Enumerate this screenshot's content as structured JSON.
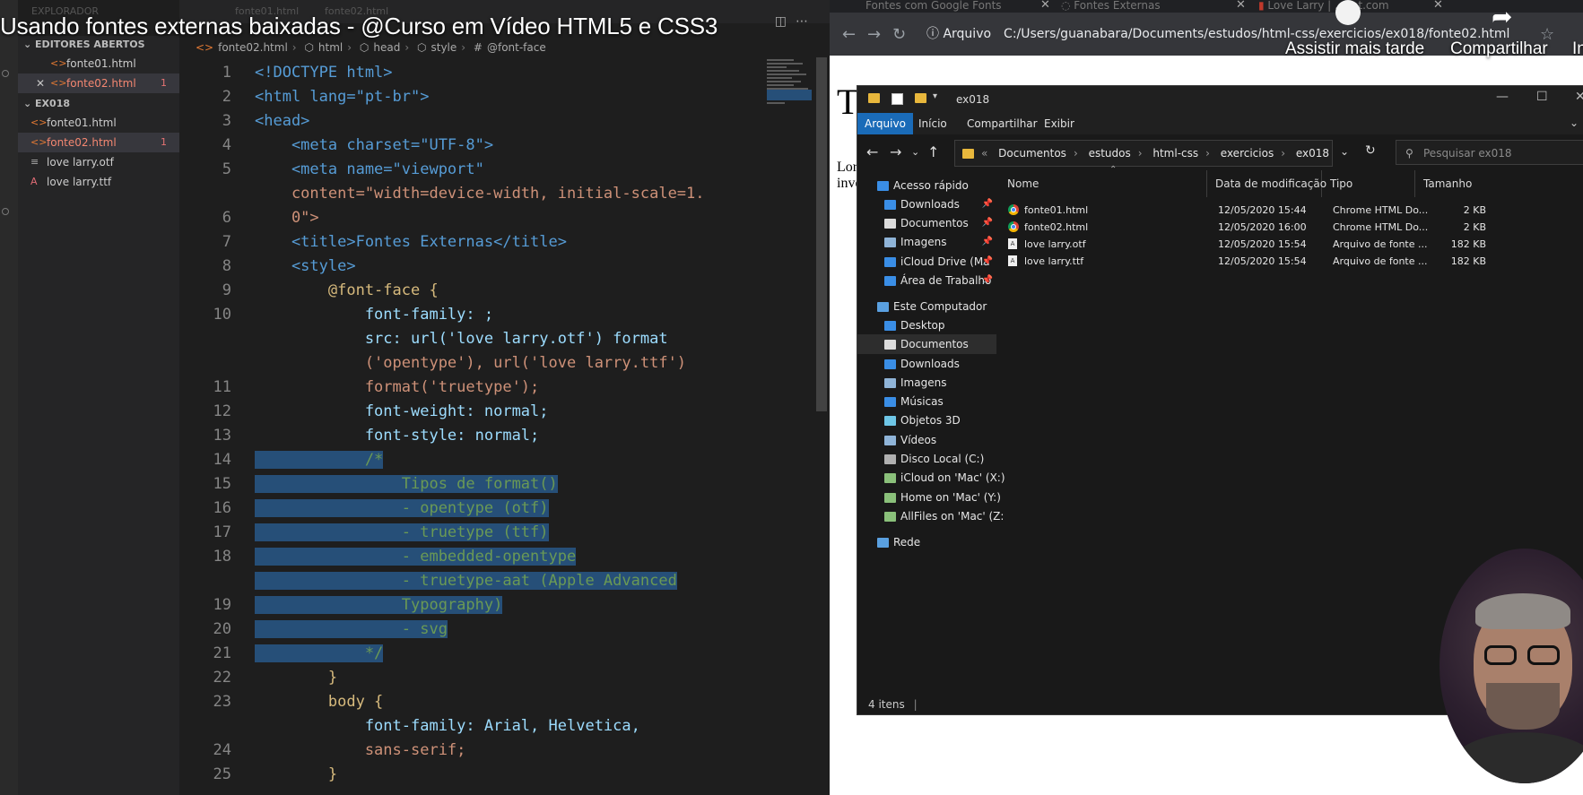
{
  "video": {
    "title": "Usando fontes externas baixadas - @Curso em Vídeo HTML5 e CSS3",
    "watch_later": "Assistir mais tarde",
    "share": "Compartilhar",
    "share_more": "In"
  },
  "vscode": {
    "faint_tabs": [
      "EXPLORADOR",
      "fonte01.html",
      "fonte02.html"
    ],
    "explorer": {
      "open_editors_header": "EDITORES ABERTOS",
      "open_editors": [
        {
          "name": "fonte01.html",
          "badge": ""
        },
        {
          "name": "fonte02.html",
          "badge": "1"
        }
      ],
      "folder_header": "EX018",
      "files": [
        {
          "name": "fonte01.html",
          "icon": "html-icon",
          "badge": ""
        },
        {
          "name": "fonte02.html",
          "icon": "html-icon",
          "badge": "1"
        },
        {
          "name": "love larry.otf",
          "icon": "font-file-icon",
          "badge": ""
        },
        {
          "name": "love larry.ttf",
          "icon": "font-file-icon",
          "badge": ""
        }
      ]
    },
    "breadcrumb": [
      "fonte02.html",
      "html",
      "head",
      "style",
      "@font-face"
    ],
    "line_numbers": [
      "1",
      "2",
      "3",
      "4",
      "5",
      "",
      "6",
      "7",
      "8",
      "9",
      "10",
      "",
      "",
      "11",
      "12",
      "13",
      "14",
      "15",
      "16",
      "17",
      "18",
      "",
      "19",
      "20",
      "21",
      "22",
      "23",
      "",
      "24",
      "25"
    ],
    "code_lines": [
      "<!DOCTYPE html>",
      "<html lang=\"pt-br\">",
      "<head>",
      "    <meta charset=\"UTF-8\">",
      "    <meta name=\"viewport\"",
      "    content=\"width=device-width, initial-scale=1.",
      "    0\">",
      "    <title>Fontes Externas</title>",
      "    <style>",
      "        @font-face {",
      "            font-family: ;",
      "            src: url('love larry.otf') format",
      "            ('opentype'), url('love larry.ttf')",
      "            format('truetype');",
      "            font-weight: normal;",
      "            font-style: normal;",
      "            /*",
      "                Tipos de format()",
      "                - opentype (otf)",
      "                - truetype (ttf)",
      "                - embedded-opentype",
      "                - truetype-aat (Apple Advanced",
      "                Typography)",
      "                - svg",
      "            */",
      "        }",
      "        body {",
      "            font-family: Arial, Helvetica,",
      "            sans-serif;",
      "        }"
    ]
  },
  "browser": {
    "tabs": [
      {
        "label": "Fontes com Google Fonts"
      },
      {
        "label": "Fontes Externas"
      },
      {
        "label": "Love Larry | ...ant.com"
      }
    ],
    "address_label": "Arquivo",
    "address_url": "C:/Users/guanabara/Documents/estudos/html-css/exercicios/ex018/fonte02.html",
    "page_heading_fragment": "T",
    "page_lorem_line1": "Lor",
    "page_lorem_line2": "inve"
  },
  "file_explorer": {
    "title": "ex018",
    "ribbon": [
      "Arquivo",
      "Início",
      "Compartilhar",
      "Exibir"
    ],
    "path": [
      "Documentos",
      "estudos",
      "html-css",
      "exercicios",
      "ex018"
    ],
    "search_placeholder": "Pesquisar ex018",
    "nav": [
      {
        "label": "Acesso rápido",
        "pinned": false
      },
      {
        "label": "Downloads",
        "pinned": true
      },
      {
        "label": "Documentos",
        "pinned": true
      },
      {
        "label": "Imagens",
        "pinned": true
      },
      {
        "label": "iCloud Drive (Ma",
        "pinned": true
      },
      {
        "label": "Área de Trabalho",
        "pinned": true
      },
      {
        "label": "Este Computador",
        "pinned": false
      },
      {
        "label": "Desktop",
        "pinned": false
      },
      {
        "label": "Documentos",
        "pinned": false
      },
      {
        "label": "Downloads",
        "pinned": false
      },
      {
        "label": "Imagens",
        "pinned": false
      },
      {
        "label": "Músicas",
        "pinned": false
      },
      {
        "label": "Objetos 3D",
        "pinned": false
      },
      {
        "label": "Vídeos",
        "pinned": false
      },
      {
        "label": "Disco Local (C:)",
        "pinned": false
      },
      {
        "label": "iCloud on 'Mac' (X:)",
        "pinned": false
      },
      {
        "label": "Home on 'Mac' (Y:)",
        "pinned": false
      },
      {
        "label": "AllFiles on 'Mac' (Z:",
        "pinned": false
      },
      {
        "label": "Rede",
        "pinned": false
      }
    ],
    "columns": [
      "Nome",
      "Data de modificação",
      "Tipo",
      "Tamanho"
    ],
    "files": [
      {
        "name": "fonte01.html",
        "date": "12/05/2020 15:44",
        "type": "Chrome HTML Do...",
        "size": "2 KB",
        "icon": "chrome-icon"
      },
      {
        "name": "fonte02.html",
        "date": "12/05/2020 16:00",
        "type": "Chrome HTML Do...",
        "size": "2 KB",
        "icon": "chrome-icon"
      },
      {
        "name": "love larry.otf",
        "date": "12/05/2020 15:54",
        "type": "Arquivo de fonte ...",
        "size": "182 KB",
        "icon": "font-file-icon"
      },
      {
        "name": "love larry.ttf",
        "date": "12/05/2020 15:54",
        "type": "Arquivo de fonte ...",
        "size": "182 KB",
        "icon": "font-file-icon"
      }
    ],
    "status": "4 itens"
  }
}
